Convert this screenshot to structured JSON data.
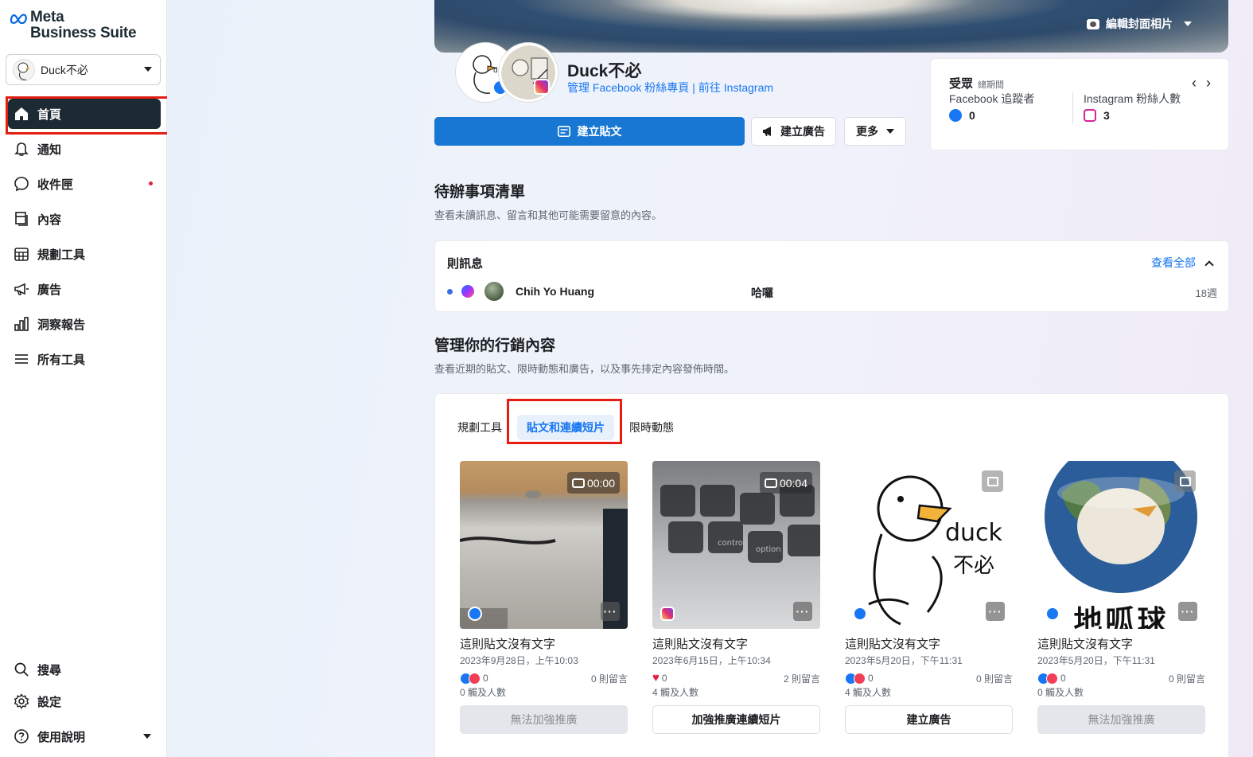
{
  "brand": {
    "line1": "Meta",
    "line2": "Business Suite"
  },
  "account": {
    "name": "Duck不必"
  },
  "nav": {
    "home": "首頁",
    "notifications": "通知",
    "inbox": "收件匣",
    "content": "內容",
    "planner": "規劃工具",
    "ads": "廣告",
    "insights": "洞察報告",
    "all_tools": "所有工具",
    "search": "搜尋",
    "settings": "設定",
    "help": "使用說明"
  },
  "cover": {
    "edit_label": "編輯封面相片"
  },
  "page": {
    "name": "Duck不必",
    "manage_link": "管理 Facebook 粉絲專頁",
    "separator": "|",
    "instagram_link": "前往 Instagram"
  },
  "actions": {
    "create_post": "建立貼文",
    "create_ad": "建立廣告",
    "more": "更多"
  },
  "audience": {
    "title": "受眾",
    "period": "總期間",
    "facebook_label": "Facebook 追蹤者",
    "facebook_value": "0",
    "instagram_label": "Instagram 粉絲人數",
    "instagram_value": "3"
  },
  "todo": {
    "title": "待辦事項清單",
    "subtitle": "查看未讀訊息、留言和其他可能需要留意的內容。",
    "card_title": "則訊息",
    "view_all": "查看全部",
    "message": {
      "from": "Chih Yo Huang",
      "text": "哈囉",
      "time": "18週"
    }
  },
  "marketing": {
    "title": "管理你的行銷內容",
    "subtitle": "查看近期的貼文、限時動態和廣告，以及事先排定內容發佈時間。",
    "tabs": [
      "規劃工具",
      "貼文和連續短片",
      "限時動態"
    ],
    "active_tab": "貼文和連續短片"
  },
  "posts": [
    {
      "title": "這則貼文沒有文字",
      "date": "2023年9月28日，上午10:03",
      "reactions": "0",
      "comments": "0 則留言",
      "reach": "0 觸及人數",
      "button": "無法加強推廣",
      "duration": "00:00",
      "platform": "facebook",
      "button_disabled": true
    },
    {
      "title": "這則貼文沒有文字",
      "date": "2023年6月15日，上午10:34",
      "reactions": "0",
      "comments": "2 則留言",
      "reach": "4 觸及人數",
      "button": "加強推廣連續短片",
      "duration": "00:04",
      "platform": "instagram",
      "button_disabled": false
    },
    {
      "title": "這則貼文沒有文字",
      "date": "2023年5月20日，下午11:31",
      "reactions": "0",
      "comments": "0 則留言",
      "reach": "4 觸及人數",
      "button": "建立廣告",
      "platform": "facebook",
      "button_disabled": false
    },
    {
      "title": "這則貼文沒有文字",
      "date": "2023年5月20日，下午11:31",
      "reactions": "0",
      "comments": "0 則留言",
      "reach": "0 觸及人數",
      "button": "無法加強推廣",
      "platform": "facebook",
      "button_disabled": true,
      "image_text": "地呱球"
    }
  ],
  "colors": {
    "primary": "#1877d2",
    "sidebar_active": "#1c2b33",
    "highlight": "#e41e12",
    "link": "#1877f2"
  }
}
